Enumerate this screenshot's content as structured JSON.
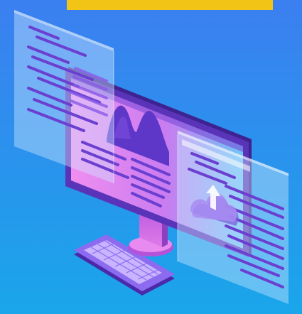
{
  "colors": {
    "background_top": "#3b7ff0",
    "background_bottom": "#1aa6ea",
    "banner": "#f2c415",
    "monitor_frame": "#5a34b8",
    "monitor_frame_side": "#3d2390",
    "screen_left": "#ee8ef0",
    "screen_right": "#6fc6f5",
    "chart_shape": "#5e36c8",
    "panel": "#bfe6ff",
    "code_line": "#6b3fd0",
    "keyboard": "#8d6bf0",
    "stand": "#d06ae0"
  },
  "icons": [
    "monitor-icon",
    "keyboard-icon",
    "cloud-upload-icon",
    "code-panel-icon"
  ]
}
